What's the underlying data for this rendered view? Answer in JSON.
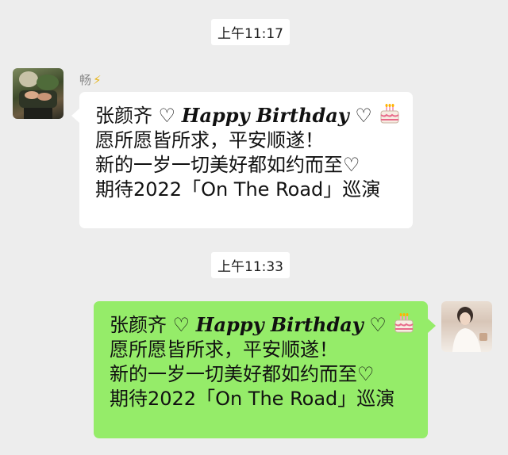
{
  "conversation": {
    "timestamp_1": "上午11:17",
    "timestamp_2": "上午11:33",
    "incoming": {
      "sender_name": "畅",
      "sender_badge": "⚡",
      "line1_prefix": "张颜齐 ♡ ",
      "line1_emphasis": "Happy Birthday",
      "line1_suffix": " ♡ ",
      "line1_icon": "birthday-cake-icon",
      "line2": "愿所愿皆所求，平安顺遂！",
      "line3": "新的一岁一切美好都如约而至♡",
      "line4": "期待2022「On The Road」巡演"
    },
    "outgoing": {
      "line1_prefix": "张颜齐 ♡ ",
      "line1_emphasis": "Happy Birthday",
      "line1_suffix": " ♡ ",
      "line1_icon": "birthday-cake-icon",
      "line2": "愿所愿皆所求，平安顺遂！",
      "line3": "新的一岁一切美好都如约而至♡",
      "line4": "期待2022「On The Road」巡演"
    }
  },
  "colors": {
    "background": "#ededed",
    "incoming_bubble": "#ffffff",
    "outgoing_bubble": "#95ec69",
    "timestamp_bg": "#ffffff"
  }
}
